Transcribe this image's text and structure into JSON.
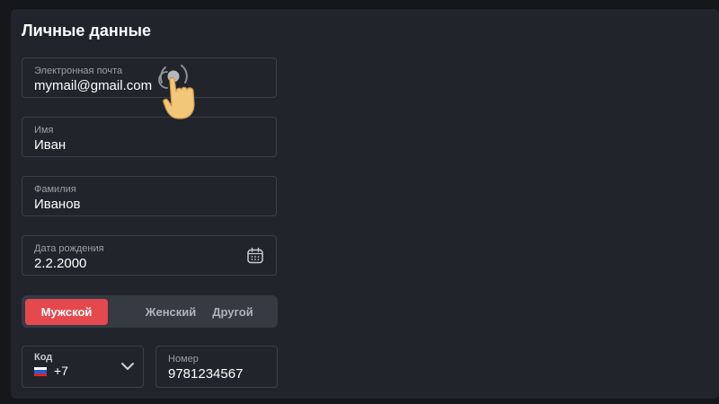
{
  "section": {
    "title": "Личные данные"
  },
  "email": {
    "label": "Электронная почта",
    "value": "mymail@gmail.com"
  },
  "first_name": {
    "label": "Имя",
    "value": "Иван"
  },
  "last_name": {
    "label": "Фамилия",
    "value": "Иванов"
  },
  "birthdate": {
    "label": "Дата рождения",
    "value": "2.2.2000",
    "icon": "calendar-icon"
  },
  "gender": {
    "options": [
      "Мужской",
      "Женский",
      "Другой"
    ],
    "selected": "Мужской"
  },
  "phone_code": {
    "label": "Код",
    "value": "+7",
    "flag": "russia-flag-icon",
    "icon": "chevron-down-icon"
  },
  "phone_number": {
    "label": "Номер",
    "value": "9781234567"
  },
  "colors": {
    "accent": "#e5484d",
    "background": "#21242a"
  },
  "cursor": {
    "icon": "hand-pointer-icon"
  }
}
